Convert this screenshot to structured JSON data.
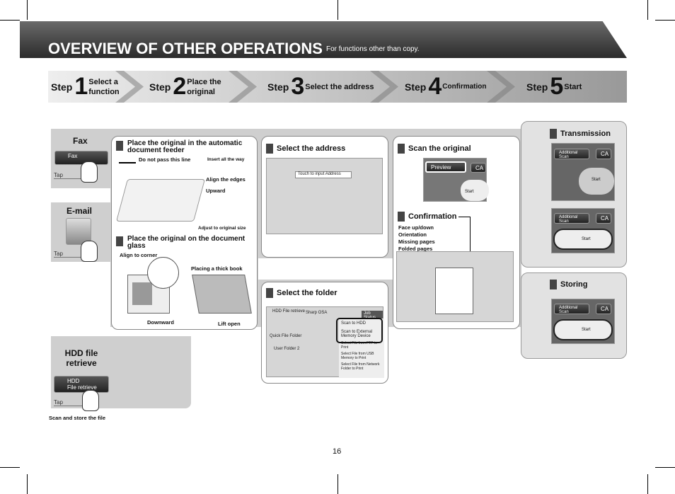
{
  "header": {
    "title": "OVERVIEW OF OTHER OPERATIONS",
    "subtitle": "For functions other than copy."
  },
  "steps": [
    {
      "word": "Step",
      "num": "1",
      "label": "Select a function"
    },
    {
      "word": "Step",
      "num": "2",
      "label": "Place the original"
    },
    {
      "word": "Step",
      "num": "3",
      "label": "Select the address"
    },
    {
      "word": "Step",
      "num": "4",
      "label": "Confirmation"
    },
    {
      "word": "Step",
      "num": "5",
      "label": "Start"
    }
  ],
  "functions": {
    "fax": {
      "title": "Fax",
      "button": "Fax",
      "tap": "Tap"
    },
    "email": {
      "title": "E-mail",
      "tap": "Tap"
    },
    "hdd": {
      "title": "HDD file retrieve",
      "button_line1": "HDD",
      "button_line2": "File retrieve",
      "tap": "Tap",
      "caption": "Scan and store the file"
    }
  },
  "place": {
    "adf_title": "Place the original in the automatic document feeder",
    "do_not_pass": "Do not pass this line",
    "insert": "Insert all the way",
    "align_edges": "Align the edges",
    "upward": "Upward",
    "adjust": "Adjust to original size",
    "glass_title": "Place the original on the document glass",
    "align_corner": "Align to corner",
    "thick_book": "Placing a thick book",
    "downward": "Downward",
    "lift_open": "Lift open"
  },
  "address": {
    "title": "Select the address",
    "input_placeholder": "Touch to input Address"
  },
  "folder": {
    "title": "Select the folder",
    "tab1": "HDD File retrieve",
    "tab2": "Sharp OSA",
    "job_status": "Job Status",
    "left_items": [
      "Quick File Folder",
      "User Folder 2"
    ],
    "right_items": [
      "Scan to HDD",
      "Scan to External Memory Device",
      "Select File from FTP to Print",
      "Select File from USB Memory to Print",
      "Select File from Network Folder to Print"
    ]
  },
  "scan": {
    "title": "Scan the original",
    "preview": "Preview",
    "ca": "CA",
    "start": "Start"
  },
  "confirm": {
    "title": "Confirmation",
    "items": [
      "Face up/down",
      "Orientation",
      "Missing pages",
      "Folded pages"
    ]
  },
  "transmission": {
    "title": "Transmission",
    "additional_scan": "Additional Scan",
    "ca": "CA",
    "start": "Start"
  },
  "storing": {
    "title": "Storing",
    "additional_scan": "Additional Scan",
    "ca": "CA",
    "start": "Start"
  },
  "page_number": "16"
}
